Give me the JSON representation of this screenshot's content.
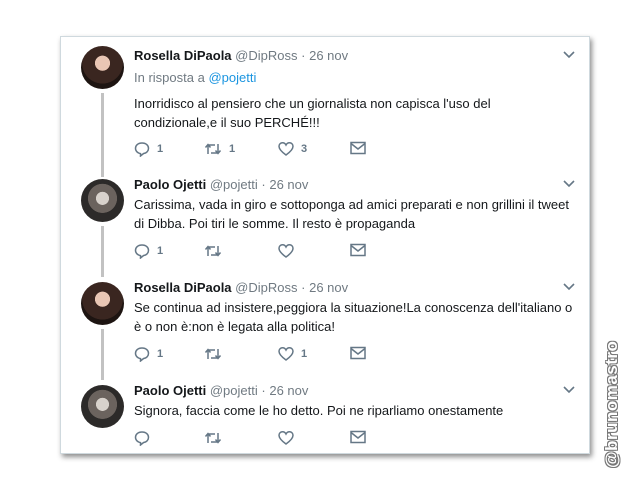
{
  "tweets": [
    {
      "name": "Rosella DiPaola",
      "handle": "@DipRoss",
      "separator": "·",
      "date": "26 nov",
      "replying_prefix": "In risposta a",
      "replying_to": "@pojetti",
      "text": "Inorridisco al pensiero che un giornalista non capisca l'uso del condizionale,e il suo PERCHÉ!!!",
      "replies": "1",
      "retweets": "1",
      "likes": "3"
    },
    {
      "name": "Paolo Ojetti",
      "handle": "@pojetti",
      "separator": "·",
      "date": "26 nov",
      "text": "Carissima, vada in giro e sottoponga ad amici preparati e non grillini il tweet di Dibba. Poi tiri le somme. Il resto è propaganda",
      "replies": "1",
      "retweets": "",
      "likes": ""
    },
    {
      "name": "Rosella DiPaola",
      "handle": "@DipRoss",
      "separator": "·",
      "date": "26 nov",
      "text": "Se continua ad insistere,peggiora la situazione!La conoscenza dell'italiano o è o non è:non è legata alla politica!",
      "replies": "1",
      "retweets": "",
      "likes": "1"
    },
    {
      "name": "Paolo Ojetti",
      "handle": "@pojetti",
      "separator": "·",
      "date": "26 nov",
      "text": "Signora, faccia come le ho detto. Poi ne riparliamo onestamente",
      "replies": "",
      "retweets": "",
      "likes": ""
    }
  ],
  "watermark": "@brunomastro",
  "icons": {
    "reply": "reply-icon",
    "retweet": "retweet-icon",
    "like": "heart-icon",
    "message": "envelope-icon",
    "menu": "chevron-down-icon"
  },
  "colors": {
    "link": "#1b95e0",
    "secondary_text": "#707a82",
    "thread_line": "#c2c2c2"
  }
}
